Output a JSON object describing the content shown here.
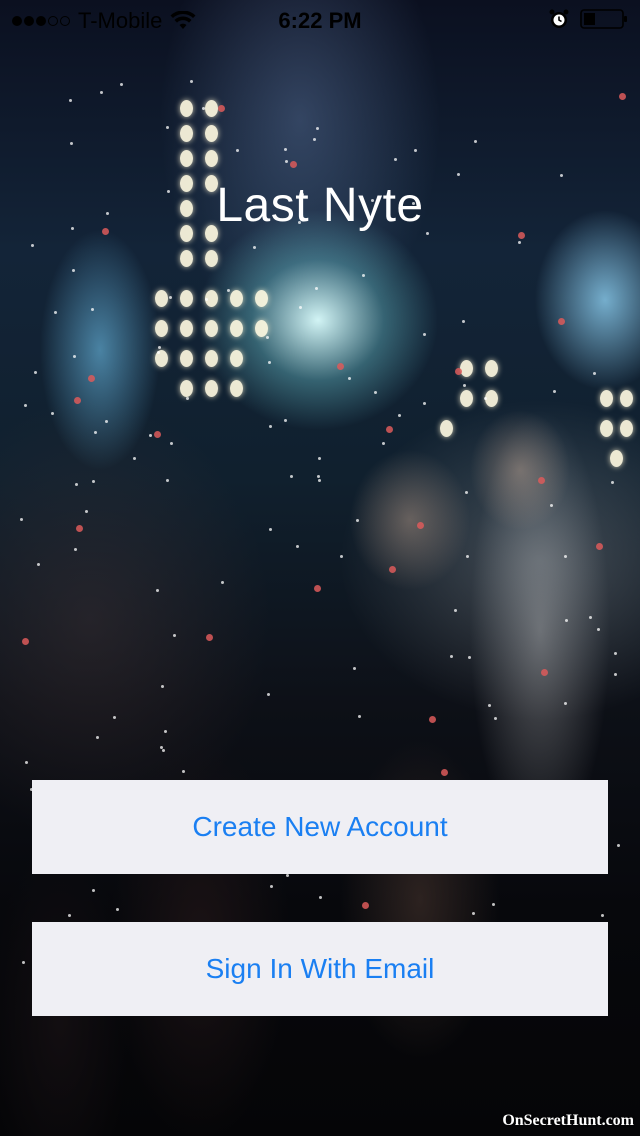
{
  "status_bar": {
    "signal_strength": "3 of 5",
    "carrier": "T-Mobile",
    "time": "6:22 PM",
    "icons": [
      "wifi-icon",
      "alarm-icon",
      "battery-icon"
    ]
  },
  "app": {
    "title": "Last Nyte"
  },
  "buttons": {
    "create_account": "Create New Account",
    "sign_in": "Sign In With Email"
  },
  "background": {
    "watermark": "OnSecretHunt.com"
  },
  "colors": {
    "button_background": "#efeff4",
    "button_text": "#1a7ff2",
    "title_text": "#ffffff"
  }
}
